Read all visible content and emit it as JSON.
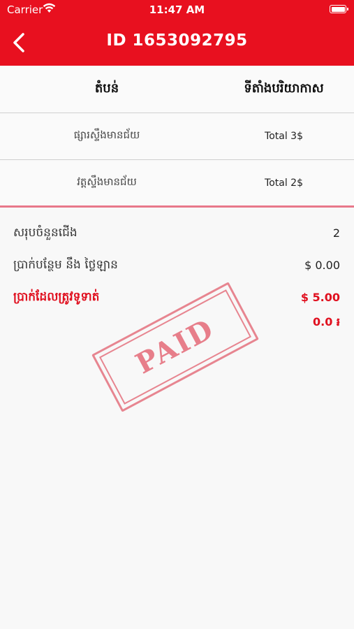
{
  "status_bar": {
    "carrier": "Carrier",
    "time": "11:47 AM"
  },
  "header": {
    "title": "ID 1653092795"
  },
  "table": {
    "columns": [
      "តំបន់",
      "ទីតាំងបរិយាកាស"
    ],
    "rows": [
      {
        "name": "ផ្សារស្ទឹងមានជ័យ",
        "value": "Total 3$"
      },
      {
        "name": "វត្តស្ទឹងមានជ័យ",
        "value": "Total 2$"
      }
    ]
  },
  "summary": {
    "count_label": "សរុបចំនួនជើង",
    "count_value": "2",
    "extra_label": "ប្រាក់បន្ថែម នឹង ថ្លៃឡាន",
    "extra_value": "$ 0.00",
    "total_label": "ប្រាក់ដែលត្រូវទូទាត់",
    "total_value": "$ 5.00",
    "total_riel": "0.0 ៛"
  },
  "stamp": {
    "text": "PAID"
  },
  "colors": {
    "accent": "#e8101f",
    "stamp": "#e25f6e"
  }
}
